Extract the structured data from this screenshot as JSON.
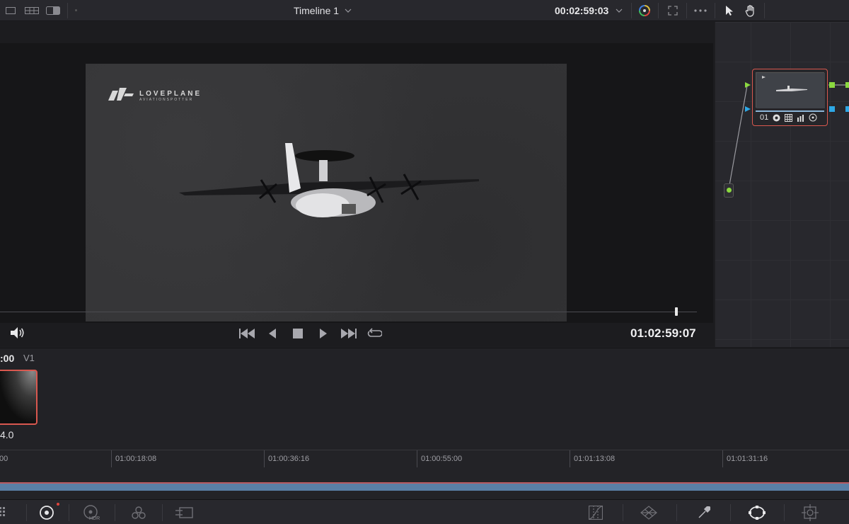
{
  "topbar": {
    "timeline_title": "Timeline 1",
    "timecode": "00:02:59:03",
    "icons": [
      "layout-single-icon",
      "layout-grid-icon",
      "layout-split-icon",
      "chevron-down-icon",
      "color-wheel-icon",
      "fullscreen-icon",
      "more-options-icon",
      "pointer-tool-icon",
      "hand-tool-icon"
    ]
  },
  "viewer": {
    "logo_main": "LOVEPLANE",
    "logo_sub": "AVIATIONSPOTTER",
    "playhead_timecode": "01:02:59:07",
    "transport": [
      "skip-to-start-icon",
      "play-reverse-icon",
      "stop-icon",
      "play-icon",
      "skip-to-end-icon",
      "loop-icon"
    ]
  },
  "node_editor": {
    "node_label": "01",
    "node_tools": [
      "effects-icon",
      "grid-icon",
      "bars-icon",
      "target-icon"
    ],
    "colors": {
      "node_border": "#d9584f",
      "rgb_port": "#8bd93f",
      "alpha_port": "#2ea8e6"
    }
  },
  "clips": {
    "clip_timecode": ":00",
    "track": "V1",
    "version": "4.0"
  },
  "ruler": {
    "ticks": [
      "00",
      "01:00:18:08",
      "01:00:36:16",
      "01:00:55:00",
      "01:01:13:08",
      "01:01:31:16"
    ]
  },
  "bottombar": {
    "left_icons": [
      "clip-list-icon",
      "color-wheels-icon",
      "hdr-icon",
      "rgb-mixer-icon",
      "motion-effects-icon"
    ],
    "hdr_label": "HDR",
    "right_icons": [
      "curves-icon",
      "color-warper-icon",
      "qualifier-icon",
      "window-icon",
      "tracker-icon"
    ]
  }
}
